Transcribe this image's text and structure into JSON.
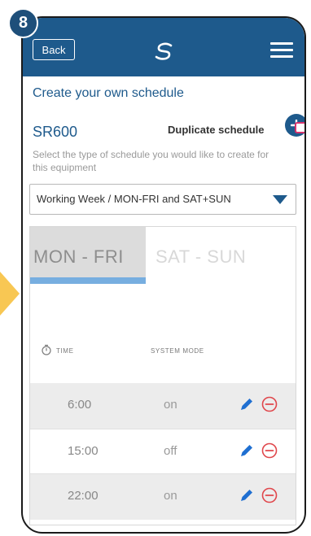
{
  "step_badge": "8",
  "header": {
    "back_label": "Back",
    "logo_icon": "s-logo-icon",
    "menu_icon": "hamburger-icon"
  },
  "page": {
    "title": "Create your own schedule",
    "device_name": "SR600",
    "duplicate_label": "Duplicate schedule",
    "duplicate_icon": "plus-icon",
    "hint": "Select the type of schedule you would like to create for this equipment"
  },
  "schedule_type": {
    "selected": "Working Week / MON-FRI and SAT+SUN"
  },
  "tabs": [
    {
      "label": "MON - FRI",
      "active": true
    },
    {
      "label": "SAT - SUN",
      "active": false
    }
  ],
  "columns": {
    "time": "TIME",
    "mode": "SYSTEM MODE"
  },
  "rows": [
    {
      "time": "6:00",
      "mode": "on"
    },
    {
      "time": "15:00",
      "mode": "off"
    },
    {
      "time": "22:00",
      "mode": "on"
    }
  ],
  "colors": {
    "brand_blue": "#1e5a8c",
    "tab_underline": "#77aee0",
    "remove_red": "#e0474c",
    "edit_blue": "#1f6fd1",
    "highlight_yellow": "#f8c753"
  }
}
